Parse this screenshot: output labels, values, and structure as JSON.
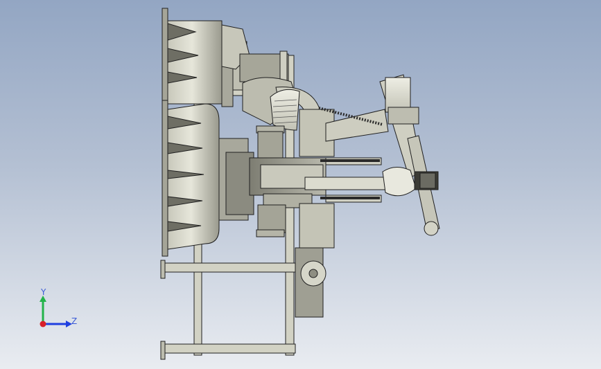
{
  "viewport": {
    "background_top": "#93a6c3",
    "background_bottom": "#e9ecf1",
    "model": {
      "name": "cad-assembly-side-view",
      "colors": {
        "edge": "#1f1f1f",
        "face_light": "#d9d9cc",
        "face_mid": "#b8b8aa",
        "face_dark": "#8c8c80",
        "face_shadow": "#5e5e56",
        "hose_dark": "#2a2a2a"
      }
    },
    "triad": {
      "y_label": "Y",
      "z_label": "Z",
      "y_color": "#23b34a",
      "z_color": "#1e3fe0",
      "x_color": "#d8202a",
      "label_color": "#3b5bd6"
    }
  }
}
